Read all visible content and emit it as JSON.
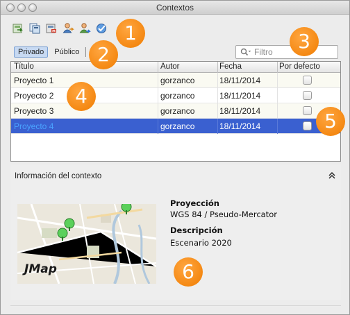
{
  "window": {
    "title": "Contextos"
  },
  "toolbar": {
    "buttons": [
      {
        "icon": "import-context-icon"
      },
      {
        "icon": "copy-context-icon"
      },
      {
        "icon": "delete-context-icon"
      },
      {
        "icon": "share-user-icon"
      },
      {
        "icon": "user-export-icon"
      },
      {
        "icon": "check-globe-icon"
      }
    ]
  },
  "badges": [
    "1",
    "2",
    "3",
    "4",
    "5",
    "6"
  ],
  "tabs": [
    {
      "label": "Privado",
      "active": true
    },
    {
      "label": "Público",
      "active": false
    }
  ],
  "search": {
    "placeholder": "Filtro",
    "value": ""
  },
  "table": {
    "columns": [
      "Título",
      "Autor",
      "Fecha",
      "Por defecto"
    ],
    "rows": [
      {
        "name": "Proyecto 1",
        "author": "gorzanco",
        "date": "18/11/2014",
        "default": false
      },
      {
        "name": "Proyecto 2",
        "author": "gorzanco",
        "date": "18/11/2014",
        "default": false
      },
      {
        "name": "Proyecto 3",
        "author": "gorzanco",
        "date": "18/11/2014",
        "default": false
      },
      {
        "name": "Proyecto 4",
        "author": "gorzanco",
        "date": "18/11/2014",
        "default": false,
        "selected": true
      }
    ]
  },
  "info": {
    "title": "Información del contexto",
    "map_logo": "JMap",
    "projection_label": "Proyección",
    "projection_value": "WGS 84 / Pseudo-Mercator",
    "description_label": "Descripción",
    "description_value": "Escenario 2020"
  },
  "colors": {
    "selection": "#3a60d0",
    "badge": "#f28a10",
    "accent_tab": "#c7d9f2"
  }
}
